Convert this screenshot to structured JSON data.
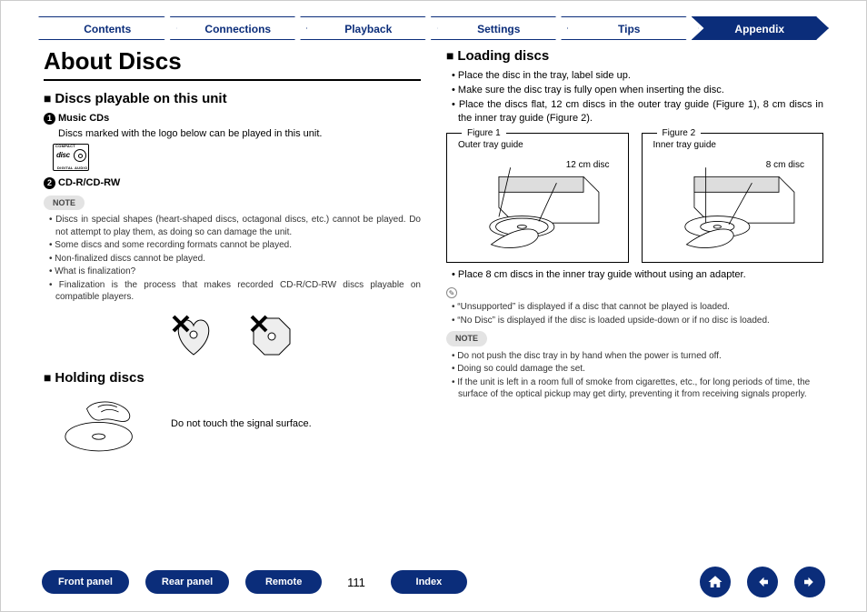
{
  "tabs": {
    "contents": "Contents",
    "connections": "Connections",
    "playback": "Playback",
    "settings": "Settings",
    "tips": "Tips",
    "appendix": "Appendix"
  },
  "title": "About Discs",
  "left": {
    "h_playable": "Discs playable on this unit",
    "item1_head": "Music CDs",
    "item1_text": "Discs marked with the logo below can be played in this unit.",
    "item2_head": "CD-R/CD-RW",
    "note_badge": "NOTE",
    "notes": [
      "Discs in special shapes (heart-shaped discs, octagonal discs, etc.) cannot be played. Do not attempt to play them, as doing so can damage the unit.",
      "Some discs and some recording formats cannot be played.",
      "Non-finalized discs cannot be played.",
      "What is finalization?",
      "Finalization is the process that makes recorded CD-R/CD-RW discs playable on compatible players."
    ],
    "h_holding": "Holding discs",
    "holding_text": "Do not touch the signal surface."
  },
  "right": {
    "h_loading": "Loading discs",
    "loading_pts": [
      "Place the disc in the tray, label side up.",
      "Make sure the disc tray is fully open when inserting the disc.",
      "Place the discs flat, 12 cm discs in the outer tray guide (Figure 1), 8 cm discs in the inner tray guide (Figure 2)."
    ],
    "fig1_cap": "Figure 1",
    "fig1_top": "Outer tray guide",
    "fig1_disc": "12 cm disc",
    "fig2_cap": "Figure 2",
    "fig2_top": "Inner tray guide",
    "fig2_disc": "8 cm disc",
    "after_fig": "Place 8 cm discs in the inner tray guide without using an adapter.",
    "info_pts": [
      "“Unsupported” is displayed if a disc that cannot be played is loaded.",
      "“No Disc” is displayed if the disc is loaded upside-down or if no disc is loaded."
    ],
    "note_badge": "NOTE",
    "note_pts": [
      "Do not push the disc tray in by hand when the power is turned off.",
      "Doing so could damage the set.",
      "If the unit is left in a room full of smoke from cigarettes, etc., for long periods of time, the surface of the optical pickup may get dirty, preventing it from receiving signals properly."
    ]
  },
  "bottom": {
    "front": "Front panel",
    "rear": "Rear panel",
    "remote": "Remote",
    "index": "Index",
    "page": "111"
  }
}
